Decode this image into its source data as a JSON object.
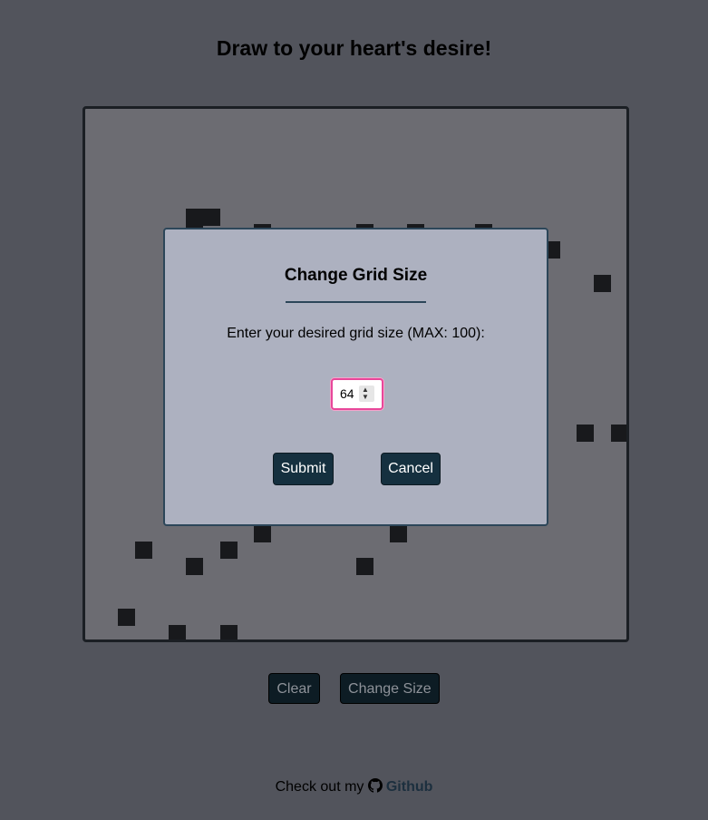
{
  "page": {
    "title": "Draw to your heart's desire!"
  },
  "controls": {
    "clear_label": "Clear",
    "change_size_label": "Change Size"
  },
  "footer": {
    "prefix": "Check out my",
    "link_label": "Github",
    "icon": "github-icon"
  },
  "modal": {
    "title": "Change Grid Size",
    "prompt": "Enter your desired grid size (MAX: 100):",
    "input_value": "64",
    "submit_label": "Submit",
    "cancel_label": "Cancel"
  },
  "colors": {
    "background": "#52545c",
    "board": "#6c6c72",
    "painted_cell": "#18191c",
    "modal_bg": "#adb1c0",
    "button_bg": "#15303f",
    "input_focus": "#e8479a"
  }
}
